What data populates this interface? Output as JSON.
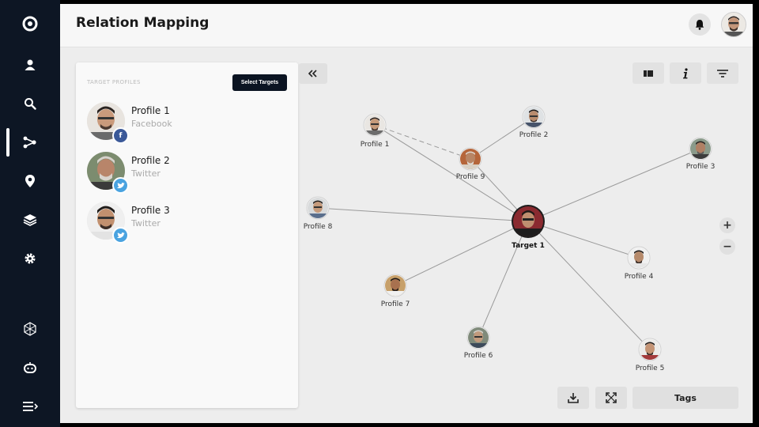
{
  "header": {
    "title": "Relation Mapping"
  },
  "sidebar": {
    "items": [
      {
        "icon": "logo-icon"
      },
      {
        "icon": "user-icon"
      },
      {
        "icon": "search-icon"
      },
      {
        "icon": "relations-icon",
        "active": true
      },
      {
        "icon": "location-icon"
      },
      {
        "icon": "layers-icon"
      },
      {
        "icon": "gear-icon"
      },
      {
        "icon": "network-icon"
      },
      {
        "icon": "bot-icon"
      },
      {
        "icon": "menu-icon"
      }
    ]
  },
  "panel": {
    "label": "TARGET PROFILES",
    "select_button": "Select Targets",
    "profiles": [
      {
        "name": "Profile 1",
        "source": "Facebook",
        "badge_color": "#3b5998",
        "badge_icon": "f"
      },
      {
        "name": "Profile 2",
        "source": "Twitter",
        "badge_color": "#4aa3e0",
        "badge_icon": "twitter-bird-icon"
      },
      {
        "name": "Profile 3",
        "source": "Twitter",
        "badge_color": "#4aa3e0",
        "badge_icon": "twitter-bird-icon"
      }
    ]
  },
  "graph": {
    "target": {
      "label": "Target 1"
    },
    "nodes": [
      {
        "label": "Profile 1"
      },
      {
        "label": "Profile 2"
      },
      {
        "label": "Profile 3"
      },
      {
        "label": "Profile 4"
      },
      {
        "label": "Profile 5"
      },
      {
        "label": "Profile 6"
      },
      {
        "label": "Profile 7"
      },
      {
        "label": "Profile 8"
      },
      {
        "label": "Profile 9"
      }
    ]
  },
  "toolbar": {
    "buttons": [
      "layout-icon",
      "info-icon",
      "filter-icon"
    ],
    "zoom_in": "+",
    "zoom_out": "−"
  },
  "bottom": {
    "download": "download-icon",
    "fullscreen": "expand-icon",
    "tags_label": "Tags"
  },
  "colors": {
    "sidebar": "#0d1624",
    "accent": "#0b1422",
    "facebook": "#3b5998",
    "twitter": "#4aa3e0"
  }
}
